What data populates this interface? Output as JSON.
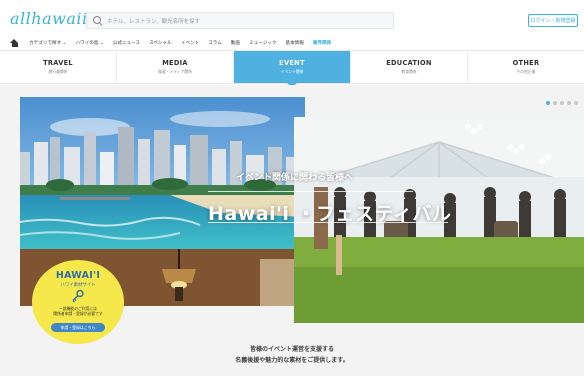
{
  "header": {
    "logo_text": "allhawaii",
    "search_placeholder": "ホテル、レストラン、観光名所を探す",
    "login_label": "ログイン・新規登録"
  },
  "menu": {
    "items": [
      {
        "label": "カテゴリで探す ⌄"
      },
      {
        "label": "ハワイの島 ⌄"
      },
      {
        "label": "公式ニュース"
      },
      {
        "label": "スペシャル"
      },
      {
        "label": "イベント"
      },
      {
        "label": "コラム"
      },
      {
        "label": "動画"
      },
      {
        "label": "ミュージック"
      },
      {
        "label": "基本情報"
      },
      {
        "label": "業界関係"
      }
    ]
  },
  "tabs": [
    {
      "en": "TRAVEL",
      "jp": "旅行業関係",
      "active": false
    },
    {
      "en": "MEDIA",
      "jp": "報道・メディア関係",
      "active": false
    },
    {
      "en": "EVENT",
      "jp": "イベント関係",
      "active": true
    },
    {
      "en": "EDUCATION",
      "jp": "教育関係",
      "active": false
    },
    {
      "en": "OTHER",
      "jp": "その他企業",
      "active": false
    }
  ],
  "hero": {
    "subtitle": "イベント関係に関わる皆様へ",
    "title": "Hawai'i ・フェスティバル"
  },
  "badge": {
    "title": "HAWAI'I",
    "subtitle": "ハワイ素材サイト",
    "note_line1": "一部機能のご利用には",
    "note_line2": "関係者申請・登録が必要です",
    "button_label": "申請・登録はこちら"
  },
  "copy": {
    "line1": "皆様のイベント運営を支援する",
    "line2": "名義後援や魅力的な素材をご提供します。"
  },
  "carousel": {
    "count": 5,
    "active_index": 0
  },
  "colors": {
    "accent": "#4eb1e0",
    "logo": "#39b3d6",
    "badge": "#f6e84a",
    "badge_text": "#2e6ea8"
  }
}
